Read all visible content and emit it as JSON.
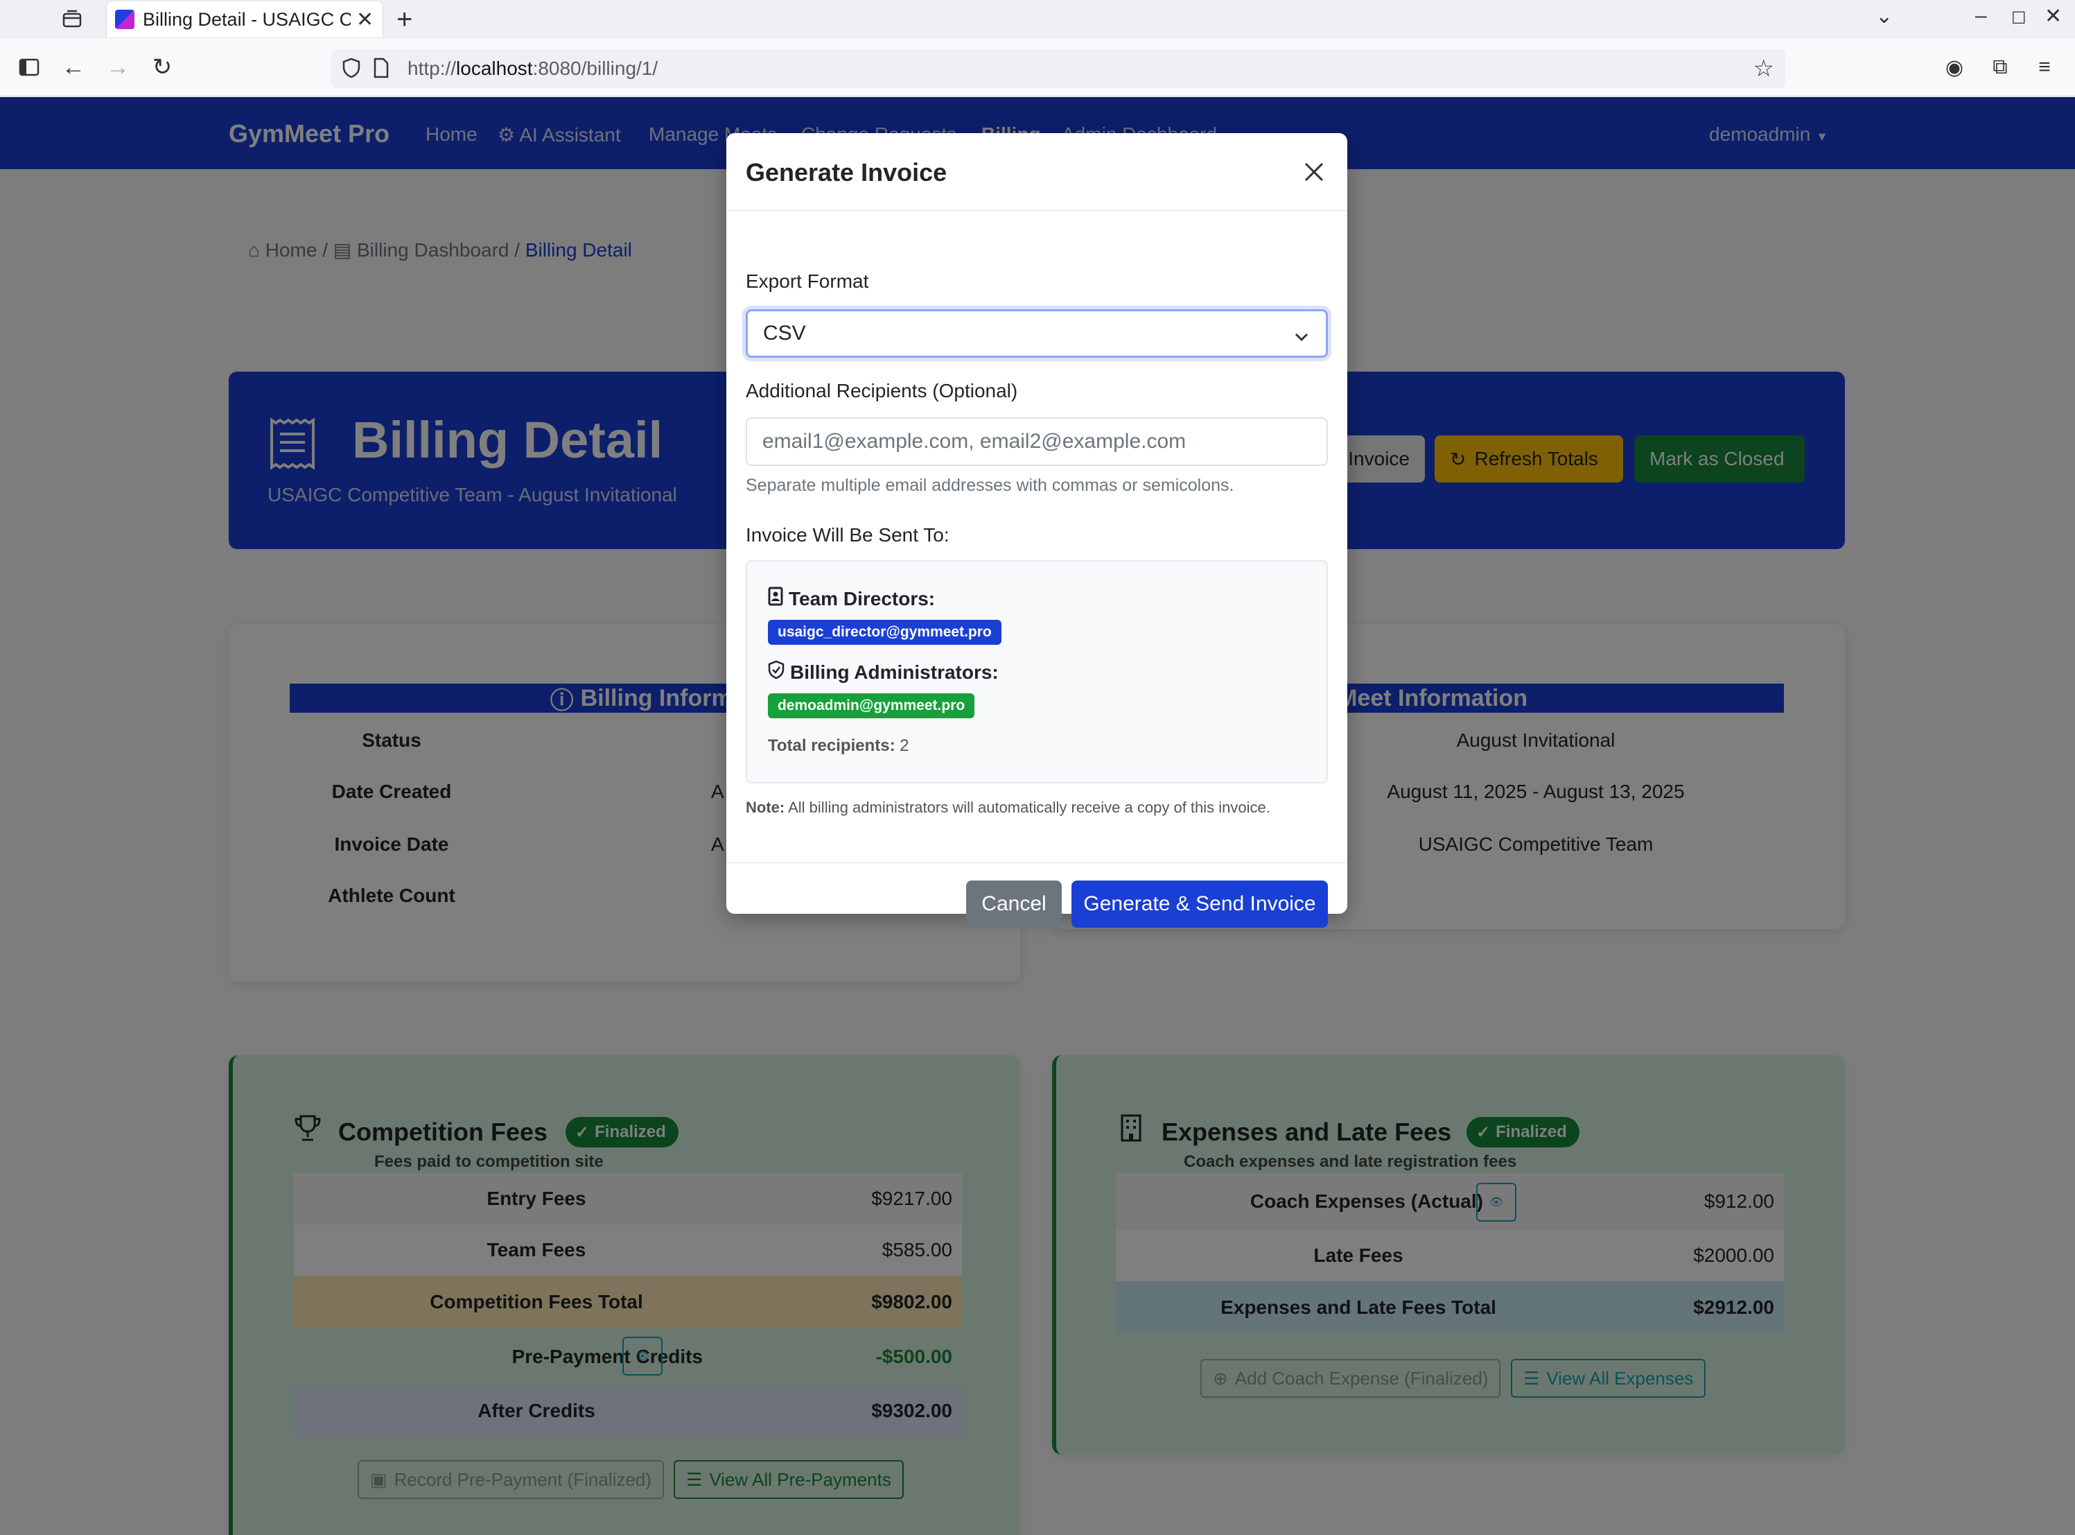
{
  "browser": {
    "tab_title": "Billing Detail - USAIGC Co",
    "url_prefix": "http://",
    "url_host": "localhost",
    "url_rest": ":8080/billing/1/"
  },
  "nav": {
    "brand": "GymMeet Pro",
    "links": [
      "Home",
      "AI Assistant",
      "Manage Meets",
      "Change Requests",
      "Billing",
      "Admin Dashboard"
    ],
    "user": "demoadmin"
  },
  "breadcrumb": {
    "home": "Home",
    "dashboard": "Billing Dashboard",
    "current": "Billing Detail"
  },
  "hero": {
    "title": "Billing Detail",
    "subtitle": "USAIGC Competitive Team - August Invitational",
    "buttons": {
      "invoice": "Invoice",
      "refresh": "Refresh Totals",
      "close": "Mark as Closed"
    }
  },
  "billing_info": {
    "heading": "Billing Informati",
    "labels": [
      "Status",
      "Date Created",
      "Invoice Date",
      "Athlete Count"
    ],
    "partial_values": [
      "A",
      "A"
    ]
  },
  "meet_info": {
    "heading": "Meet Information",
    "values": [
      "August Invitational",
      "August 11, 2025 - August 13, 2025",
      "USAIGC Competitive Team"
    ]
  },
  "competition_fees": {
    "title": "Competition Fees",
    "badge": "Finalized",
    "subtitle": "Fees paid to competition site",
    "rows": [
      {
        "label": "Entry Fees",
        "value": "$9217.00"
      },
      {
        "label": "Team Fees",
        "value": "$585.00"
      },
      {
        "label": "Competition Fees Total",
        "value": "$9802.00"
      },
      {
        "label": "Pre-Payment Credits",
        "value": "-$500.00"
      },
      {
        "label": "After Credits",
        "value": "$9302.00"
      }
    ],
    "buttons": {
      "record": "Record Pre-Payment (Finalized)",
      "view": "View All Pre-Payments"
    }
  },
  "expenses": {
    "title": "Expenses and Late Fees",
    "badge": "Finalized",
    "subtitle": "Coach expenses and late registration fees",
    "rows": [
      {
        "label": "Coach Expenses (Actual)",
        "value": "$912.00"
      },
      {
        "label": "Late Fees",
        "value": "$2000.00"
      },
      {
        "label": "Expenses and Late Fees Total",
        "value": "$2912.00"
      }
    ],
    "buttons": {
      "add": "Add Coach Expense (Finalized)",
      "view": "View All Expenses"
    }
  },
  "modal": {
    "title": "Generate Invoice",
    "format_label": "Export Format",
    "format_value": "CSV",
    "recipients_label": "Additional Recipients (Optional)",
    "recipients_placeholder": "email1@example.com, email2@example.com",
    "help_text": "Separate multiple email addresses with commas or semicolons.",
    "sent_to_label": "Invoice Will Be Sent To:",
    "directors_label": "Team Directors:",
    "director_email": "usaigc_director@gymmeet.pro",
    "admins_label": "Billing Administrators:",
    "admin_email": "demoadmin@gymmeet.pro",
    "total_label": "Total recipients:",
    "total_value": "2",
    "note_label": "Note:",
    "note_text": "All billing administrators will automatically receive a copy of this invoice.",
    "cancel": "Cancel",
    "submit": "Generate & Send Invoice"
  },
  "colors": {
    "primary": "#1a3fd4",
    "success": "#17893a",
    "warning": "#ffc107",
    "secondary": "#6c757d"
  }
}
